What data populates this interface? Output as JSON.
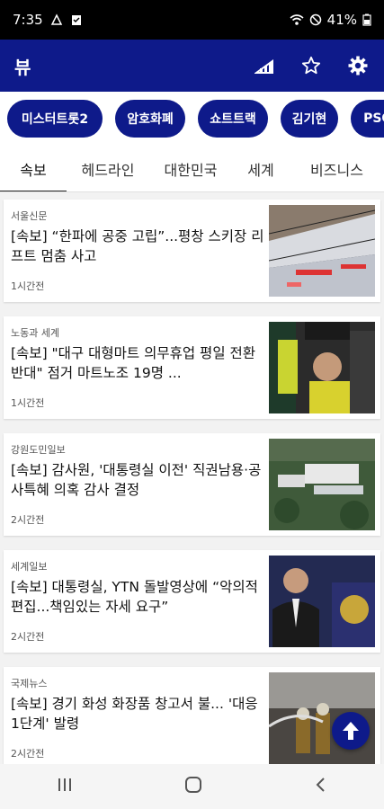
{
  "status": {
    "time": "7:35",
    "battery": "41%"
  },
  "appbar": {
    "title": "뷰"
  },
  "chips": [
    "미스터트롯2",
    "암호화폐",
    "쇼트트랙",
    "김기현",
    "PSG"
  ],
  "tabs": [
    "속보",
    "헤드라인",
    "대한민국",
    "세계",
    "비즈니스"
  ],
  "articles": [
    {
      "source": "서울신문",
      "headline": "[속보] “한파에 공중 고립”...평창 스키장 리프트 멈춤 사고",
      "time": "1시간전"
    },
    {
      "source": "노동과 세계",
      "headline": "[속보] \"대구 대형마트 의무휴업 평일 전환 반대\" 점거 마트노조 19명 ...",
      "time": "1시간전"
    },
    {
      "source": "강원도민일보",
      "headline": "[속보] 감사원, '대통령실 이전' 직권남용·공사특혜 의혹 감사 결정",
      "time": "2시간전"
    },
    {
      "source": "세계일보",
      "headline": "[속보] 대통령실, YTN 돌발영상에 “악의적 편집...책임있는 자세 요구”",
      "time": "2시간전"
    },
    {
      "source": "국제뉴스",
      "headline": "[속보] 경기 화성 화장품 창고서 불... '대응 1단계' 발령",
      "time": "2시간전"
    }
  ],
  "colors": {
    "brand": "#0e1a8a",
    "statusbar": "#000000"
  }
}
